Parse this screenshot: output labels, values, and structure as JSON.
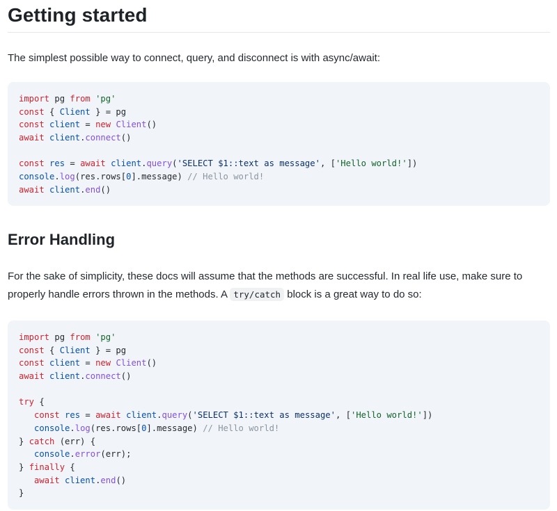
{
  "section1": {
    "title": "Getting started",
    "intro": "The simplest possible way to connect, query, and disconnect is with async/await:"
  },
  "code1": {
    "lines": [
      [
        [
          "kw",
          "import"
        ],
        [
          "t",
          " pg "
        ],
        [
          "kw",
          "from"
        ],
        [
          "t",
          " "
        ],
        [
          "strg",
          "'pg'"
        ]
      ],
      [
        [
          "kw",
          "const"
        ],
        [
          "t",
          " { "
        ],
        [
          "var",
          "Client"
        ],
        [
          "t",
          " } = pg"
        ]
      ],
      [
        [
          "kw",
          "const"
        ],
        [
          "t",
          " "
        ],
        [
          "var",
          "client"
        ],
        [
          "t",
          " = "
        ],
        [
          "kw",
          "new"
        ],
        [
          "t",
          " "
        ],
        [
          "fn",
          "Client"
        ],
        [
          "t",
          "()"
        ]
      ],
      [
        [
          "kw",
          "await"
        ],
        [
          "t",
          " "
        ],
        [
          "var",
          "client"
        ],
        [
          "t",
          "."
        ],
        [
          "fn",
          "connect"
        ],
        [
          "t",
          "()"
        ]
      ],
      [],
      [
        [
          "kw",
          "const"
        ],
        [
          "t",
          " "
        ],
        [
          "var",
          "res"
        ],
        [
          "t",
          " = "
        ],
        [
          "kw",
          "await"
        ],
        [
          "t",
          " "
        ],
        [
          "var",
          "client"
        ],
        [
          "t",
          "."
        ],
        [
          "fn",
          "query"
        ],
        [
          "t",
          "("
        ],
        [
          "str",
          "'SELECT $1::text as message'"
        ],
        [
          "t",
          ", ["
        ],
        [
          "strg",
          "'Hello world!'"
        ],
        [
          "t",
          "])"
        ]
      ],
      [
        [
          "var",
          "console"
        ],
        [
          "t",
          "."
        ],
        [
          "fn",
          "log"
        ],
        [
          "t",
          "(res.rows["
        ],
        [
          "num",
          "0"
        ],
        [
          "t",
          "].message) "
        ],
        [
          "cm",
          "// Hello world!"
        ]
      ],
      [
        [
          "kw",
          "await"
        ],
        [
          "t",
          " "
        ],
        [
          "var",
          "client"
        ],
        [
          "t",
          "."
        ],
        [
          "fn",
          "end"
        ],
        [
          "t",
          "()"
        ]
      ]
    ]
  },
  "section2": {
    "title": "Error Handling",
    "para_part1": "For the sake of simplicity, these docs will assume that the methods are successful. In real life use, make sure to properly handle errors thrown in the methods. A ",
    "inline_code": "try/catch",
    "para_part2": " block is a great way to do so:"
  },
  "code2": {
    "lines": [
      [
        [
          "kw",
          "import"
        ],
        [
          "t",
          " pg "
        ],
        [
          "kw",
          "from"
        ],
        [
          "t",
          " "
        ],
        [
          "strg",
          "'pg'"
        ]
      ],
      [
        [
          "kw",
          "const"
        ],
        [
          "t",
          " { "
        ],
        [
          "var",
          "Client"
        ],
        [
          "t",
          " } = pg"
        ]
      ],
      [
        [
          "kw",
          "const"
        ],
        [
          "t",
          " "
        ],
        [
          "var",
          "client"
        ],
        [
          "t",
          " = "
        ],
        [
          "kw",
          "new"
        ],
        [
          "t",
          " "
        ],
        [
          "fn",
          "Client"
        ],
        [
          "t",
          "()"
        ]
      ],
      [
        [
          "kw",
          "await"
        ],
        [
          "t",
          " "
        ],
        [
          "var",
          "client"
        ],
        [
          "t",
          "."
        ],
        [
          "fn",
          "connect"
        ],
        [
          "t",
          "()"
        ]
      ],
      [],
      [
        [
          "kw",
          "try"
        ],
        [
          "t",
          " {"
        ]
      ],
      [
        [
          "t",
          "   "
        ],
        [
          "kw",
          "const"
        ],
        [
          "t",
          " "
        ],
        [
          "var",
          "res"
        ],
        [
          "t",
          " = "
        ],
        [
          "kw",
          "await"
        ],
        [
          "t",
          " "
        ],
        [
          "var",
          "client"
        ],
        [
          "t",
          "."
        ],
        [
          "fn",
          "query"
        ],
        [
          "t",
          "("
        ],
        [
          "str",
          "'SELECT $1::text as message'"
        ],
        [
          "t",
          ", ["
        ],
        [
          "strg",
          "'Hello world!'"
        ],
        [
          "t",
          "])"
        ]
      ],
      [
        [
          "t",
          "   "
        ],
        [
          "var",
          "console"
        ],
        [
          "t",
          "."
        ],
        [
          "fn",
          "log"
        ],
        [
          "t",
          "(res.rows["
        ],
        [
          "num",
          "0"
        ],
        [
          "t",
          "].message) "
        ],
        [
          "cm",
          "// Hello world!"
        ]
      ],
      [
        [
          "t",
          "} "
        ],
        [
          "kw",
          "catch"
        ],
        [
          "t",
          " (err) {"
        ]
      ],
      [
        [
          "t",
          "   "
        ],
        [
          "var",
          "console"
        ],
        [
          "t",
          "."
        ],
        [
          "fn",
          "error"
        ],
        [
          "t",
          "(err);"
        ]
      ],
      [
        [
          "t",
          "} "
        ],
        [
          "kw",
          "finally"
        ],
        [
          "t",
          " {"
        ]
      ],
      [
        [
          "t",
          "   "
        ],
        [
          "kw",
          "await"
        ],
        [
          "t",
          " "
        ],
        [
          "var",
          "client"
        ],
        [
          "t",
          "."
        ],
        [
          "fn",
          "end"
        ],
        [
          "t",
          "()"
        ]
      ],
      [
        [
          "t",
          "}"
        ]
      ]
    ]
  }
}
